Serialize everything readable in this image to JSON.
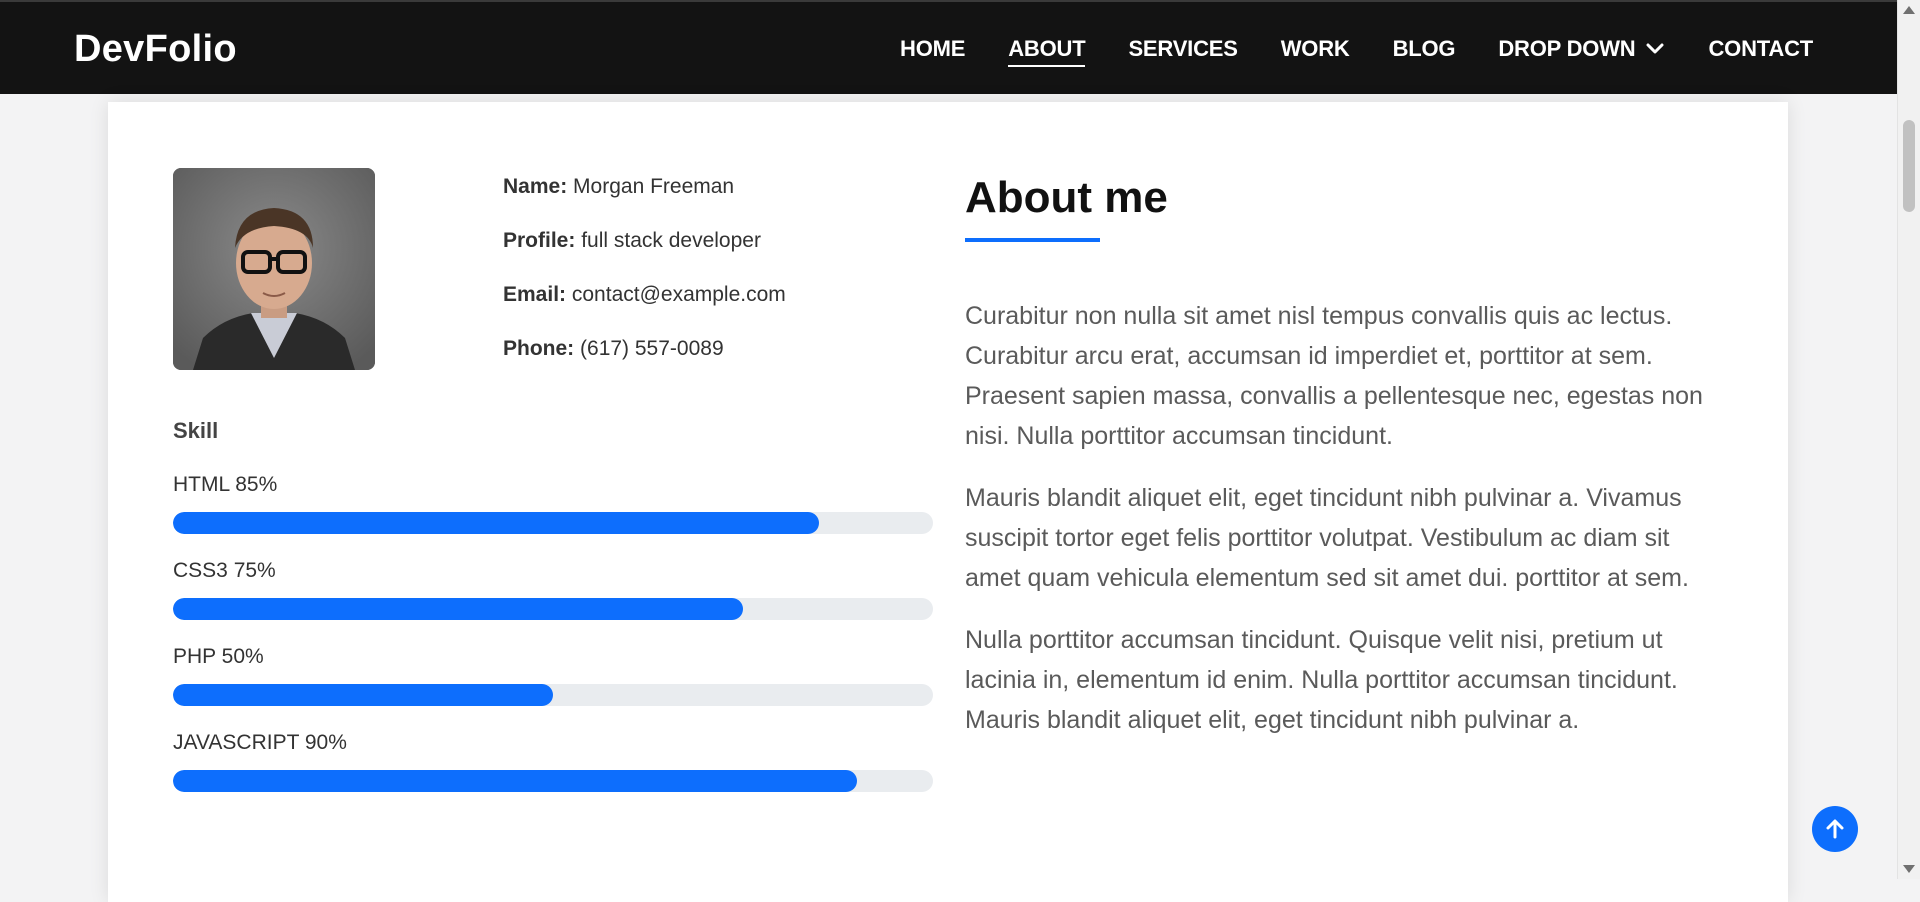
{
  "brand": "DevFolio",
  "nav": {
    "items": [
      {
        "label": "HOME",
        "active": false
      },
      {
        "label": "ABOUT",
        "active": true
      },
      {
        "label": "SERVICES",
        "active": false
      },
      {
        "label": "WORK",
        "active": false
      },
      {
        "label": "BLOG",
        "active": false
      },
      {
        "label": "DROP DOWN",
        "active": false,
        "has_dropdown": true
      },
      {
        "label": "CONTACT",
        "active": false
      }
    ]
  },
  "profile": {
    "name_label": "Name:",
    "name_value": "Morgan Freeman",
    "profile_label": "Profile:",
    "profile_value": "full stack developer",
    "email_label": "Email:",
    "email_value": "contact@example.com",
    "phone_label": "Phone:",
    "phone_value": "(617) 557-0089"
  },
  "skills": {
    "title": "Skill",
    "items": [
      {
        "label": "HTML 85%",
        "percent": 85
      },
      {
        "label": "CSS3 75%",
        "percent": 75
      },
      {
        "label": "PHP 50%",
        "percent": 50
      },
      {
        "label": "JAVASCRIPT 90%",
        "percent": 90
      }
    ]
  },
  "about": {
    "title": "About me",
    "paragraphs": [
      "Curabitur non nulla sit amet nisl tempus convallis quis ac lectus. Curabitur arcu erat, accumsan id imperdiet et, porttitor at sem. Praesent sapien massa, convallis a pellentesque nec, egestas non nisi. Nulla porttitor accumsan tincidunt.",
      "Mauris blandit aliquet elit, eget tincidunt nibh pulvinar a. Vivamus suscipit tortor eget felis porttitor volutpat. Vestibulum ac diam sit amet quam vehicula elementum sed sit amet dui. porttitor at sem.",
      "Nulla porttitor accumsan tincidunt. Quisque velit nisi, pretium ut lacinia in, elementum id enim. Nulla porttitor accumsan tincidunt. Mauris blandit aliquet elit, eget tincidunt nibh pulvinar a."
    ]
  },
  "icons": {
    "dropdown": "chevron-down-icon",
    "back_to_top": "arrow-up-icon",
    "avatar": "person-photo"
  },
  "colors": {
    "accent": "#0d6efd",
    "navbar_bg": "#131313"
  }
}
